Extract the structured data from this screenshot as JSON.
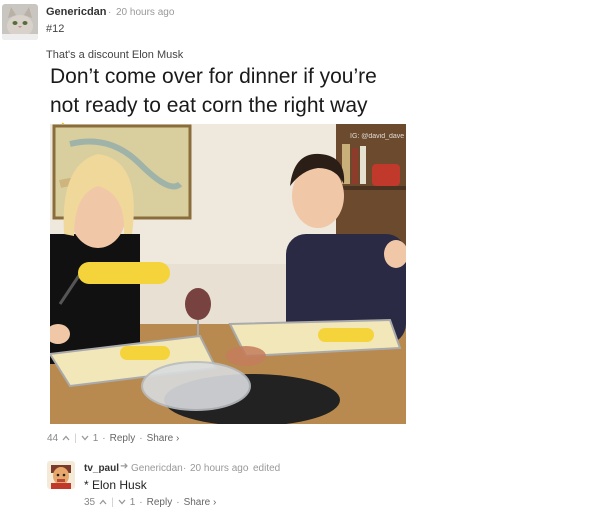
{
  "comment": {
    "username": "Genericdan",
    "time": "20 hours ago",
    "number": "#12",
    "text": "That's a discount Elon Musk",
    "meme_caption": "Don’t come over for dinner if you’re not ready to eat corn the right way 👌",
    "watermark": "IG: @david_dave",
    "upvotes": "44",
    "up_icon": "chevron-up-icon",
    "down_icon": "chevron-down-icon",
    "downvotes": "1",
    "reply_label": "Reply",
    "share_label": "Share ›"
  },
  "reply": {
    "username": "tv_paul",
    "replying_to": "Genericdan",
    "time": "20 hours ago",
    "edited": "edited",
    "text": "* Elon Husk",
    "upvotes": "35",
    "downvotes": "1",
    "reply_label": "Reply",
    "share_label": "Share ›"
  },
  "separator_dot": "·"
}
